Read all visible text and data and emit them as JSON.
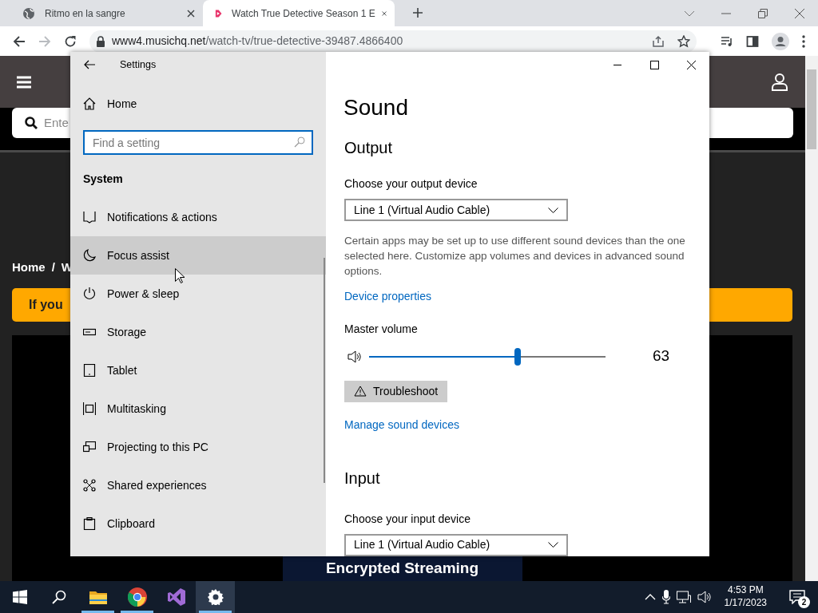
{
  "browser": {
    "tabs": [
      {
        "title": "Ritmo en la sangre",
        "selected": false
      },
      {
        "title": "Watch True Detective Season 1 E",
        "selected": true
      }
    ],
    "address": {
      "host": "www4.musichq.net",
      "path": "/watch-tv/true-detective-39487.4866400"
    }
  },
  "website": {
    "search_placeholder": "Ente",
    "breadcrumb": [
      "Home",
      "/",
      "W"
    ],
    "banner": "If you",
    "promo": "Encrypted Streaming"
  },
  "settings": {
    "title": "Settings",
    "home": "Home",
    "search": {
      "placeholder": "Find a setting"
    },
    "section": "System",
    "nav": [
      {
        "label": "Notifications & actions",
        "hovered": false
      },
      {
        "label": "Focus assist",
        "hovered": true
      },
      {
        "label": "Power & sleep",
        "hovered": false
      },
      {
        "label": "Storage",
        "hovered": false
      },
      {
        "label": "Tablet",
        "hovered": false
      },
      {
        "label": "Multitasking",
        "hovered": false
      },
      {
        "label": "Projecting to this PC",
        "hovered": false
      },
      {
        "label": "Shared experiences",
        "hovered": false
      },
      {
        "label": "Clipboard",
        "hovered": false
      }
    ],
    "page_title": "Sound",
    "output": {
      "heading": "Output",
      "device_label": "Choose your output device",
      "device": "Line 1 (Virtual Audio Cable)",
      "note": "Certain apps may be set up to use different sound devices than the one selected here. Customize app volumes and devices in advanced sound options.",
      "properties_link": "Device properties",
      "volume_label": "Master volume",
      "volume": {
        "level": 0.63,
        "reading": "63"
      },
      "troubleshoot": "Troubleshoot",
      "manage_link": "Manage sound devices"
    },
    "input": {
      "heading": "Input",
      "device_label": "Choose your input device",
      "device": "Line 1 (Virtual Audio Cable)"
    }
  },
  "taskbar": {
    "apps": [
      {
        "kind": "explorer",
        "running": true,
        "active": false
      },
      {
        "kind": "chrome",
        "running": true,
        "active": false
      },
      {
        "kind": "studio",
        "running": false,
        "active": false
      },
      {
        "kind": "settings",
        "running": true,
        "active": true
      }
    ],
    "time": "4:53 PM",
    "date": "1/17/2023",
    "notifications": "2"
  }
}
